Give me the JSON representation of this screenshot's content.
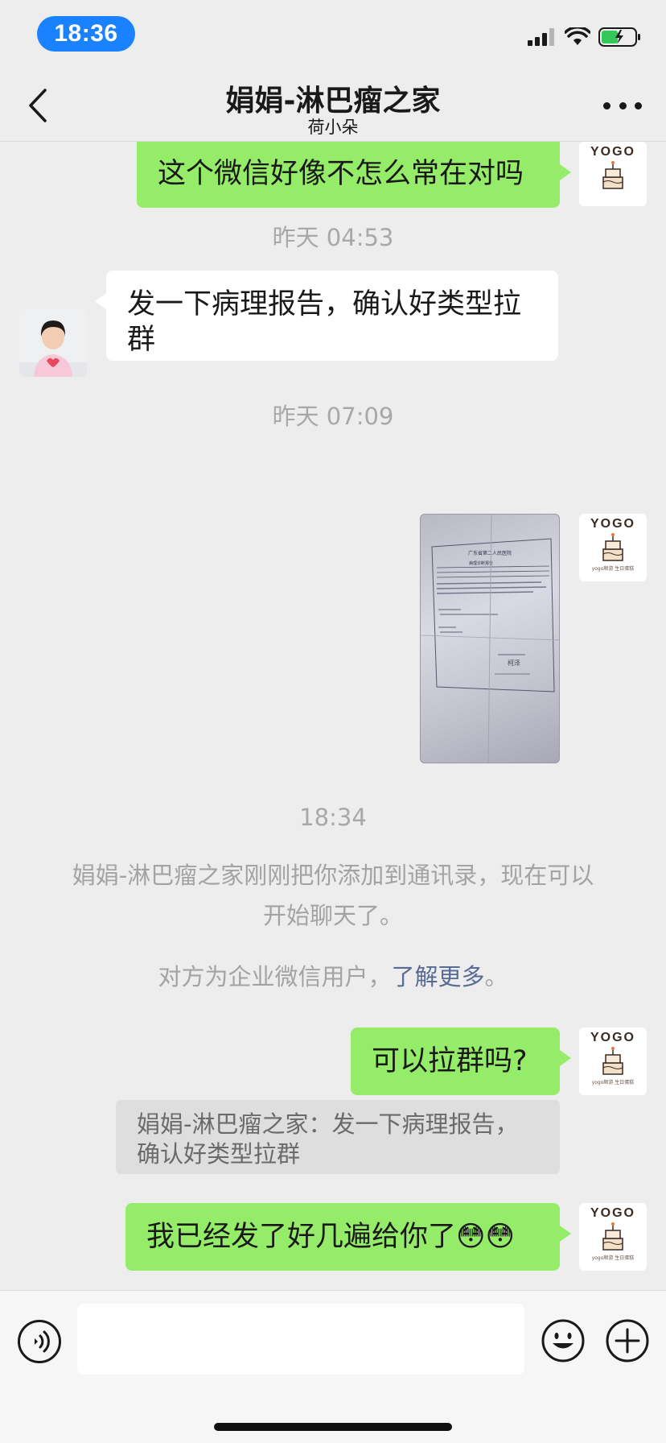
{
  "status_bar": {
    "time": "18:36"
  },
  "nav": {
    "title": "娟娟-淋巴瘤之家",
    "subtitle": "荷小朵"
  },
  "messages": {
    "m1": "这个微信好像不怎么常在对吗",
    "ts1": "昨天 04:53",
    "m2_line1": "发一下病理报告，确认好类型拉",
    "m2_line2": "群",
    "ts2": "昨天 07:09",
    "ts3": "18:34",
    "sys1_line1": "娟娟-淋巴瘤之家刚刚把你添加到通讯录，现在可以",
    "sys1_line2": "开始聊天了。",
    "sys2_prefix": "对方为企业微信用户，",
    "sys2_link": "了解更多",
    "sys2_suffix": "。",
    "m3": "可以拉群吗?",
    "quote_line1": "娟娟-淋巴瘤之家：发一下病理报告，",
    "quote_line2": "确认好类型拉群",
    "m4_text": "我已经发了好几遍给你了",
    "m4_emoji": "😳😳"
  },
  "avatar": {
    "brand": "YOGO",
    "brand_sub": "yogo顺游 生日蛋糕"
  },
  "photo_doc": {
    "header": "广东省第二人民医院",
    "subheader": "病理诊断报告",
    "sign": "柯泽"
  },
  "colors": {
    "sent_bubble": "#95ec69",
    "received_bubble": "#ffffff",
    "background": "#ededed",
    "link": "#576b95",
    "status_pill": "#1a82ff"
  },
  "icons": {
    "back": "chevron-left-icon",
    "more": "more-icon",
    "voice": "voice-icon",
    "emoji": "emoji-icon",
    "plus": "plus-icon"
  }
}
